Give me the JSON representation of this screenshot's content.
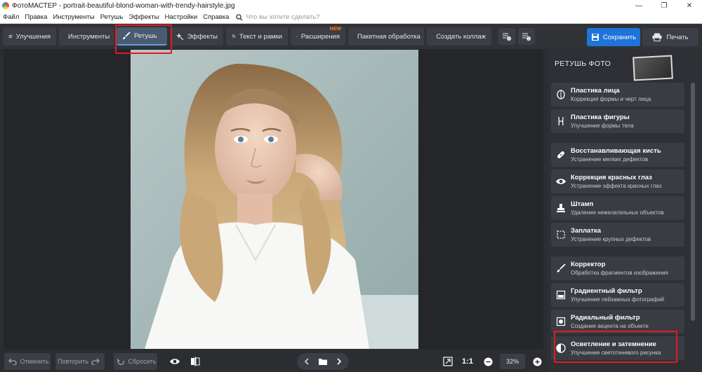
{
  "window": {
    "title": "ФотоМАСТЕР - portrait-beautiful-blond-woman-with-trendy-hairstyle.jpg"
  },
  "menu": {
    "items": [
      "Файл",
      "Правка",
      "Инструменты",
      "Ретушь",
      "Эффекты",
      "Настройки",
      "Справка"
    ],
    "search_placeholder": "Что вы хотите сделать?"
  },
  "toolbar": {
    "tabs": [
      {
        "label": "Улучшения",
        "icon": "sliders-icon"
      },
      {
        "label": "Инструменты",
        "icon": "crop-icon"
      },
      {
        "label": "Ретушь",
        "icon": "brush-icon",
        "active": true
      },
      {
        "label": "Эффекты",
        "icon": "sparkle-icon"
      },
      {
        "label": "Текст и рамки",
        "icon": "text-icon"
      },
      {
        "label": "Расширения",
        "icon": "plus-icon",
        "badge": "NEW"
      },
      {
        "label": "Пакетная обработка",
        "icon": "image-stack-icon"
      },
      {
        "label": "Создать коллаж",
        "icon": "collage-icon"
      }
    ],
    "save_label": "Сохранить",
    "print_label": "Печать"
  },
  "bottom": {
    "undo_label": "Отменить",
    "redo_label": "Повторить",
    "reset_label": "Сбросить",
    "one_to_one": "1:1",
    "zoom": "32%"
  },
  "panel": {
    "title": "РЕТУШЬ ФОТО",
    "tools": [
      {
        "name": "Пластика лица",
        "desc": "Коррекция формы и черт лица",
        "icon": "face-icon"
      },
      {
        "name": "Пластика фигуры",
        "desc": "Улучшение формы тела",
        "icon": "body-icon"
      },
      {
        "name": "Восстанавливающая кисть",
        "desc": "Устранение мелких дефектов",
        "icon": "bandage-icon"
      },
      {
        "name": "Коррекция красных глаз",
        "desc": "Устранение эффекта красных глаз",
        "icon": "eye-icon"
      },
      {
        "name": "Штамп",
        "desc": "Удаление нежелательных объектов",
        "icon": "stamp-icon"
      },
      {
        "name": "Заплатка",
        "desc": "Устранение крупных дефектов",
        "icon": "patch-icon"
      },
      {
        "name": "Корректор",
        "desc": "Обработка фрагментов изображения",
        "icon": "brush-icon"
      },
      {
        "name": "Градиентный фильтр",
        "desc": "Улучшение пейзажных фотографий",
        "icon": "gradient-icon"
      },
      {
        "name": "Радиальный фильтр",
        "desc": "Создание акцента на объекте",
        "icon": "radial-icon"
      },
      {
        "name": "Осветление и затемнение",
        "desc": "Улучшение светотеневого рисунка",
        "icon": "dodge-burn-icon"
      }
    ]
  }
}
